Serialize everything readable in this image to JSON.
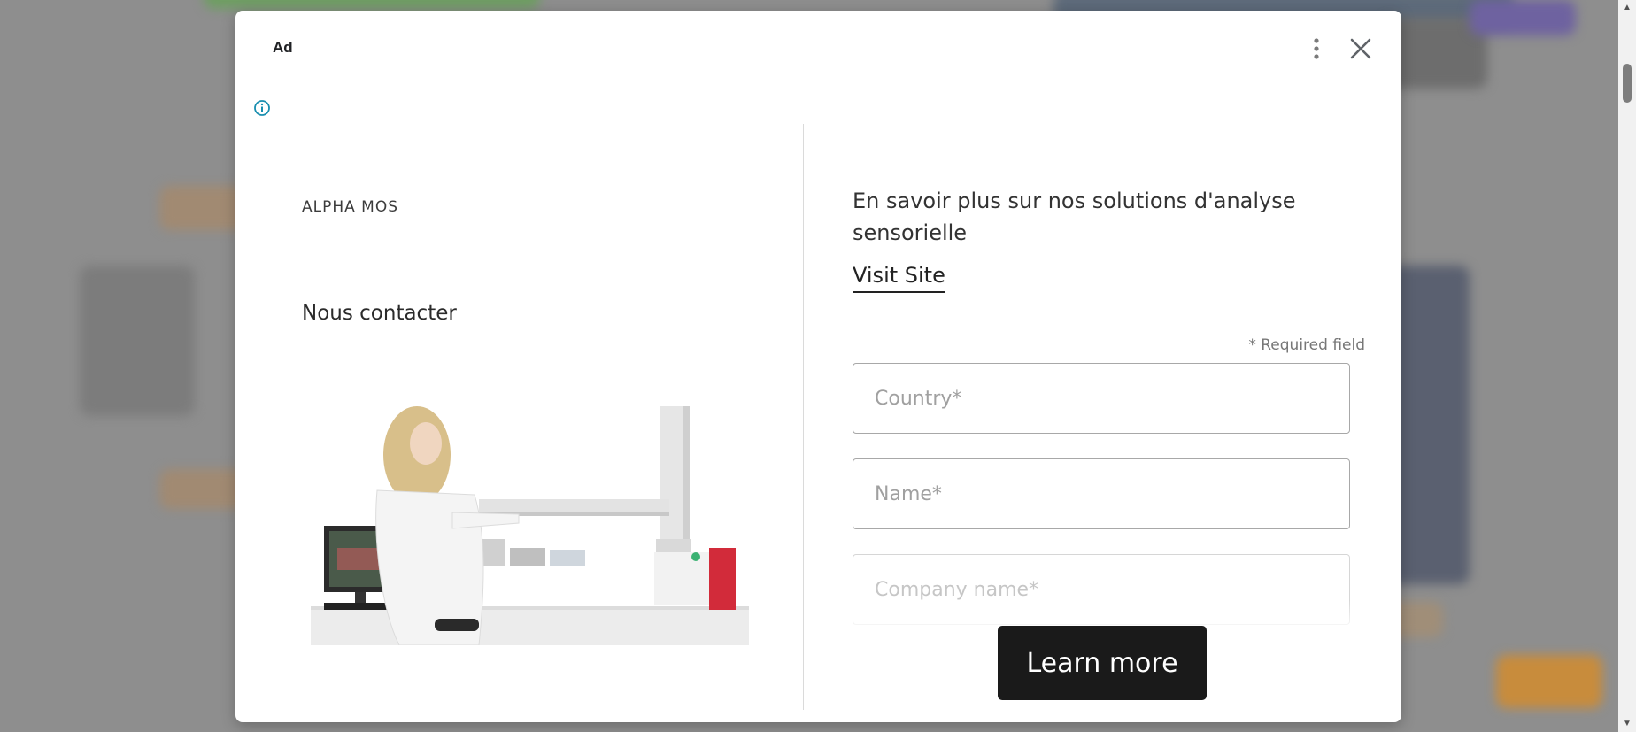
{
  "ad": {
    "label": "Ad",
    "brand": "ALPHA MOS",
    "contact_heading": "Nous contacter",
    "headline": "En savoir plus sur nos solutions d'analyse sensorielle",
    "visit_site": "Visit Site",
    "required_note": "* Required field",
    "form": {
      "country_placeholder": "Country*",
      "name_placeholder": "Name*",
      "company_placeholder": "Company name*"
    },
    "cta": "Learn more"
  },
  "icons": {
    "more": "more-vertical-icon",
    "close": "close-icon",
    "info": "info-icon"
  },
  "colors": {
    "cta_background": "#1a1a1a",
    "info_icon": "#1a8fb0",
    "overlay": "#8e8e8e"
  }
}
